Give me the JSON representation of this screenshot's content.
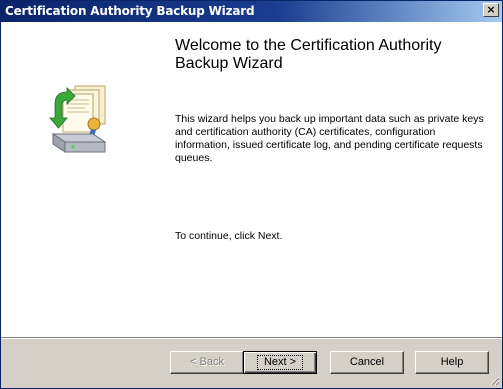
{
  "window": {
    "title": "Certification Authority Backup Wizard",
    "close_glyph": "×"
  },
  "wizard": {
    "heading": "Welcome to the Certification Authority Backup Wizard",
    "description": "This wizard helps you back up important data such as private keys and certification authority (CA) certificates, configuration information, issued certificate log, and pending certificate requests queues.",
    "continue_text": "To continue, click Next.",
    "icon": "certificate-backup-icon"
  },
  "buttons": {
    "back": "< Back",
    "next": "Next >",
    "cancel": "Cancel",
    "help": "Help"
  },
  "colors": {
    "title_bar_start": "#0a246a",
    "title_bar_end": "#a6caf0",
    "dialog_face": "#d4d0c8",
    "content_bg": "#ffffff"
  }
}
